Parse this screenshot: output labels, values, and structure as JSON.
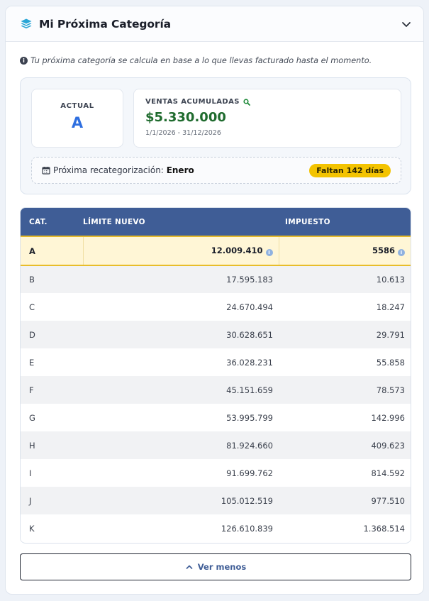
{
  "header": {
    "title": "Mi Próxima Categoría"
  },
  "info": {
    "text": "Tu próxima categoría se calcula en base a lo que llevas facturado hasta el momento."
  },
  "summary": {
    "actual_label": "ACTUAL",
    "actual_value": "A",
    "ventas_label": "VENTAS ACUMULADAS",
    "ventas_amount": "$5.330.000",
    "ventas_range": "1/1/2026 - 31/12/2026",
    "recat_label": "Próxima recategorización:",
    "recat_month": "Enero",
    "recat_badge": "Faltan 142 días"
  },
  "table": {
    "headers": {
      "cat": "CAT.",
      "limite": "LÍMITE NUEVO",
      "impuesto": "IMPUESTO"
    },
    "rows": [
      {
        "cat": "A",
        "limite": "12.009.410",
        "impuesto": "5586"
      },
      {
        "cat": "B",
        "limite": "17.595.183",
        "impuesto": "10.613"
      },
      {
        "cat": "C",
        "limite": "24.670.494",
        "impuesto": "18.247"
      },
      {
        "cat": "D",
        "limite": "30.628.651",
        "impuesto": "29.791"
      },
      {
        "cat": "E",
        "limite": "36.028.231",
        "impuesto": "55.858"
      },
      {
        "cat": "F",
        "limite": "45.151.659",
        "impuesto": "78.573"
      },
      {
        "cat": "G",
        "limite": "53.995.799",
        "impuesto": "142.996"
      },
      {
        "cat": "H",
        "limite": "81.924.660",
        "impuesto": "409.623"
      },
      {
        "cat": "I",
        "limite": "91.699.762",
        "impuesto": "814.592"
      },
      {
        "cat": "J",
        "limite": "105.012.519",
        "impuesto": "977.510"
      },
      {
        "cat": "K",
        "limite": "126.610.839",
        "impuesto": "1.368.514"
      }
    ]
  },
  "footer": {
    "toggle_label": "Ver menos"
  },
  "colors": {
    "header_bg": "#3f5d96",
    "highlight_row": "#fff6d6",
    "accent_gold": "#f3c300",
    "amount_green": "#1f6b2e",
    "actual_blue": "#2f6fe0"
  },
  "icons": [
    "layers-icon",
    "chevron-down-icon",
    "info-icon",
    "search-icon",
    "calendar-icon",
    "chevron-up-icon"
  ]
}
